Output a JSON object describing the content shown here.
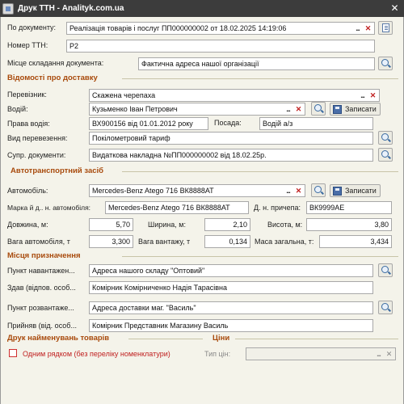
{
  "window": {
    "title": "Друк ТТН - Analityk.com.ua"
  },
  "labels": {
    "po_dokumentu": "По документу:",
    "nomer_ttn": "Номер ТТН:",
    "mistse_skladannya": "Місце складання документа:",
    "pereviznyk": "Перевізник:",
    "vodiy": "Водій:",
    "prava_vodiya": "Права водія:",
    "posada": "Посада:",
    "vyd_perevezennya": "Вид перевезення:",
    "supr_dokumenty": "Супр. документи:",
    "avtomobil": "Автомобіль:",
    "marka": "Марка й д.. н. автомобіля:",
    "dn_prychepa": "Д. н. причепа:",
    "dovzhyna": "Довжина, м:",
    "shyryna": "Ширина, м:",
    "vysota": "Висота, м:",
    "vaga_avto": "Вага автомобіля, т",
    "vaga_vantazhu": "Вага вантажу, т",
    "masa_zagalna": "Маса загальна, т:",
    "punkt_navantazhennya": "Пункт навантажен...",
    "zdav": "Здав (відпов. особ...",
    "punkt_rozvantazhennya": "Пункт розвантаже...",
    "pryynyav": "Прийняв (від. особ...",
    "odnym_ryadkom": "Одним рядком (без переліку номенклатури)",
    "typ_tsin": "Тип цін:"
  },
  "sections": {
    "delivery": "Відомості про доставку",
    "vehicle": "Автотранспортний засіб",
    "destination": "Місця призначення",
    "print_names": "Друк найменувань товарів",
    "prices": "Ціни"
  },
  "buttons": {
    "save": "Записати",
    "dots": "...",
    "clear": "✕"
  },
  "values": {
    "po_dokumentu": "Реалізація товарів і послуг ПП000000002 от 18.02.2025 14:19:06",
    "nomer_ttn": "Р2",
    "mistse_skladannya": "Фактична адреса нашої організації",
    "pereviznyk": "Скажена черепаха",
    "vodiy": "Кузьменко Іван Петрович",
    "prava_vodiya": "ВХ900156 від 01.01.2012 року",
    "posada": "Водій а/з",
    "vyd_perevezennya": "Покілометровий тариф",
    "supr_dokumenty": "Видаткова накладна №ПП000000002 від 18.02.25р.",
    "avtomobil": "Mercedes-Benz Atego 716 ВК8888АТ",
    "marka": "Mercedes-Benz Atego 716 ВК8888АТ",
    "dn_prychepa": "ВК9999АЕ",
    "dovzhyna": "5,70",
    "shyryna": "2,10",
    "vysota": "3,80",
    "vaga_avto": "3,300",
    "vaga_vantazhu": "0,134",
    "masa_zagalna": "3,434",
    "punkt_navantazhennya": "Адреса нашого складу \"Оптовий\"",
    "zdav": "Комірник Комірниченко Надія Тарасівна",
    "punkt_rozvantazhennya": "Адреса доставки маг. \"Василь\"",
    "pryynyav": "Комірник Представник Магазину Василь",
    "typ_tsin": "",
    "odnym_ryadkom_checked": false
  },
  "icons": {
    "magnifier": "magnifier-icon",
    "copy": "copy-document-icon",
    "save": "floppy-disk-icon"
  },
  "colors": {
    "section_title": "#a84a0c",
    "checkbox_label": "#c02020",
    "titlebar": "#3c3c3c"
  }
}
